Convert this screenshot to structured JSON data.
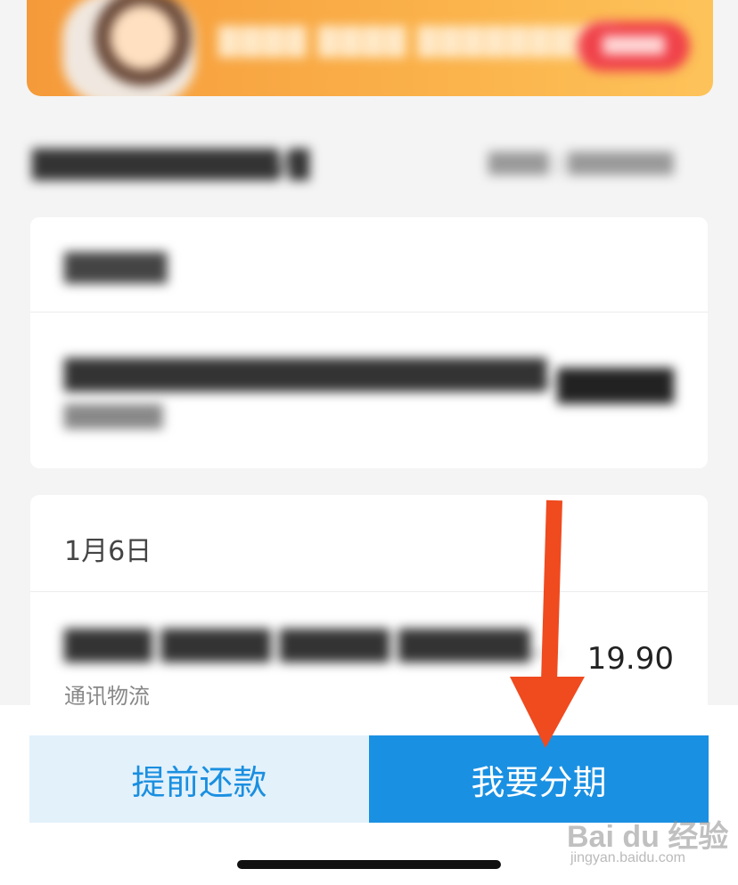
{
  "banner": {
    "text": "████ ████  █████████",
    "button": "█████"
  },
  "section": {
    "title": "████████████/█",
    "right": "████ | ███████"
  },
  "card1": {
    "date": "█████",
    "item_title": "██████████████████████…",
    "item_sub": "██████",
    "amount": "█████"
  },
  "card2": {
    "date": "1月6日",
    "item_title": "████ █████ █████ ██████…",
    "item_sub": "通讯物流",
    "amount": "19.90"
  },
  "actions": {
    "prepay_label": "提前还款",
    "installment_label": "我要分期"
  },
  "watermark": {
    "logo": "Bai du 经验",
    "url": "jingyan.baidu.com"
  },
  "colors": {
    "accent": "#1a90e2",
    "arrow": "#f04a1f",
    "banner": "#f8a640"
  }
}
